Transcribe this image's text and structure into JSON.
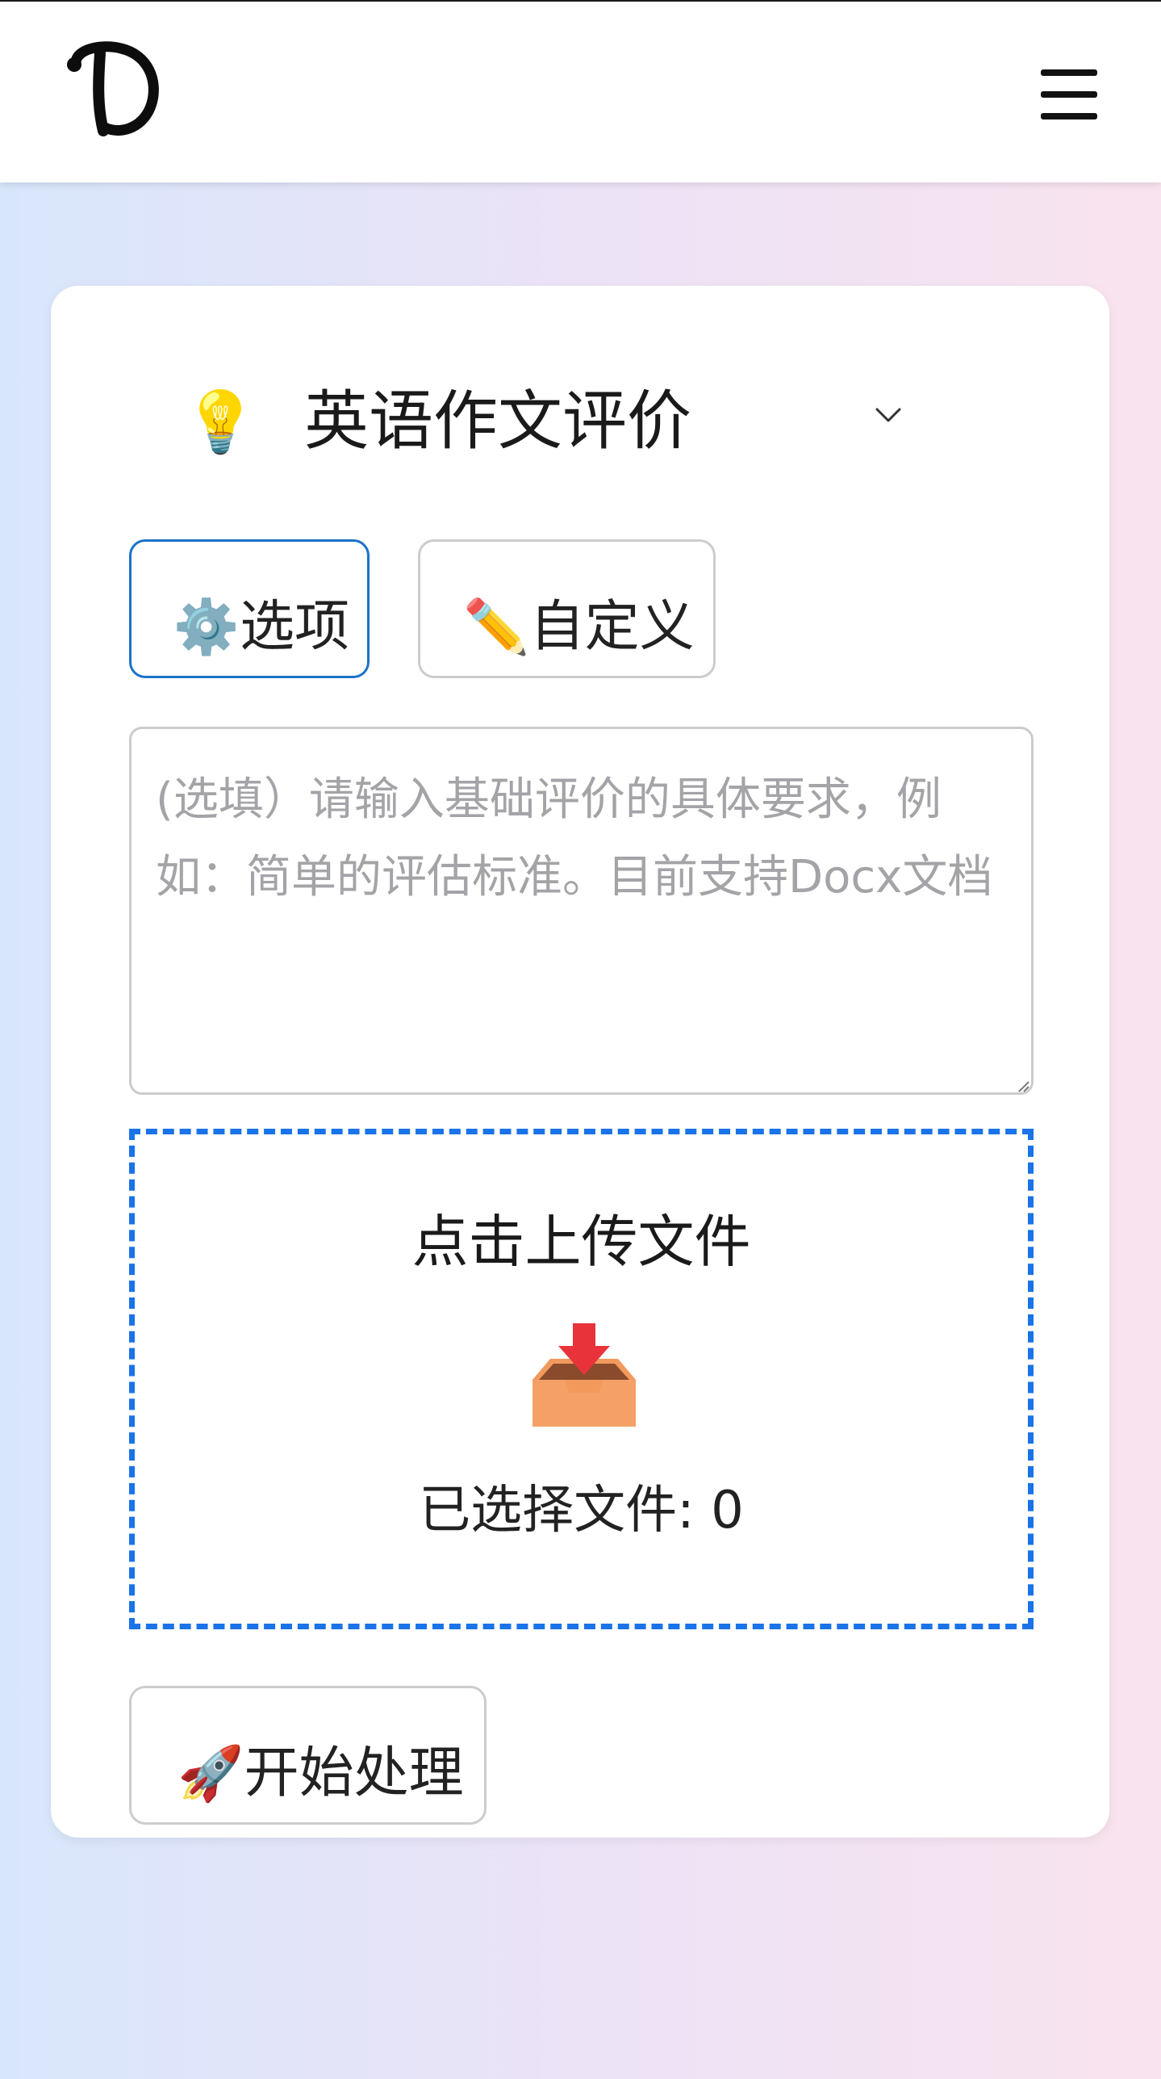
{
  "header": {
    "logo_letter": "D",
    "menu_icon": "hamburger-menu-icon"
  },
  "mode_selector": {
    "icon": "💡",
    "selected": "英语作文评价"
  },
  "buttons": {
    "options_icon": "⚙️",
    "options_label": "选项",
    "custom_icon": "✏️",
    "custom_label": "自定义",
    "start_icon": "🚀",
    "start_label": "开始处理"
  },
  "requirements": {
    "value": "",
    "placeholder": "(选填）请输入基础评价的具体要求，例如：简单的评估标准。目前支持Docx文档"
  },
  "upload": {
    "title": "点击上传文件",
    "icon": "inbox-tray-icon",
    "count_text": "已选择文件: 0"
  },
  "colors": {
    "accent": "#1a73e8",
    "active_border": "#1a73c9",
    "placeholder": "#a4a4a8"
  }
}
